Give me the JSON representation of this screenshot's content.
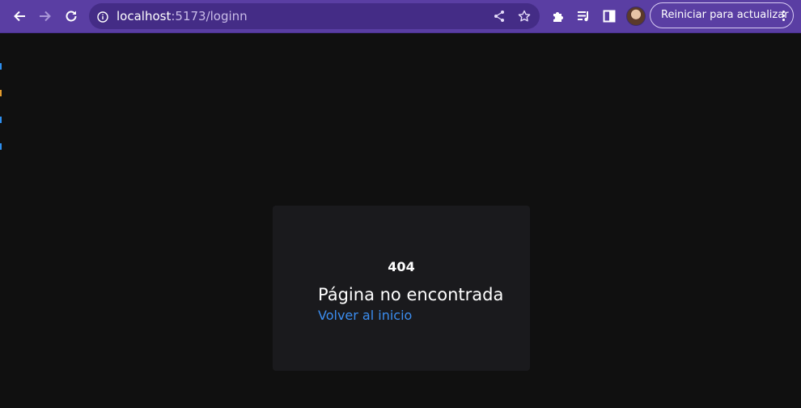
{
  "browser": {
    "url_host": "localhost",
    "url_path": ":5173/loginn",
    "update_button_label": "Reiniciar para actualizar",
    "icons": [
      "back-icon",
      "forward-icon",
      "reload-icon",
      "info-icon",
      "share-icon",
      "star-icon",
      "extensions-icon",
      "media-icon",
      "side-panel-icon",
      "profile-avatar",
      "more-icon"
    ],
    "accent_color": "#5a3ea3"
  },
  "page": {
    "error_code": "404",
    "message": "Página no encontrada",
    "back_link": "Volver al inicio",
    "link_color": "#3b8df0",
    "background_color": "#101010",
    "card_color": "#1a1a1d"
  }
}
